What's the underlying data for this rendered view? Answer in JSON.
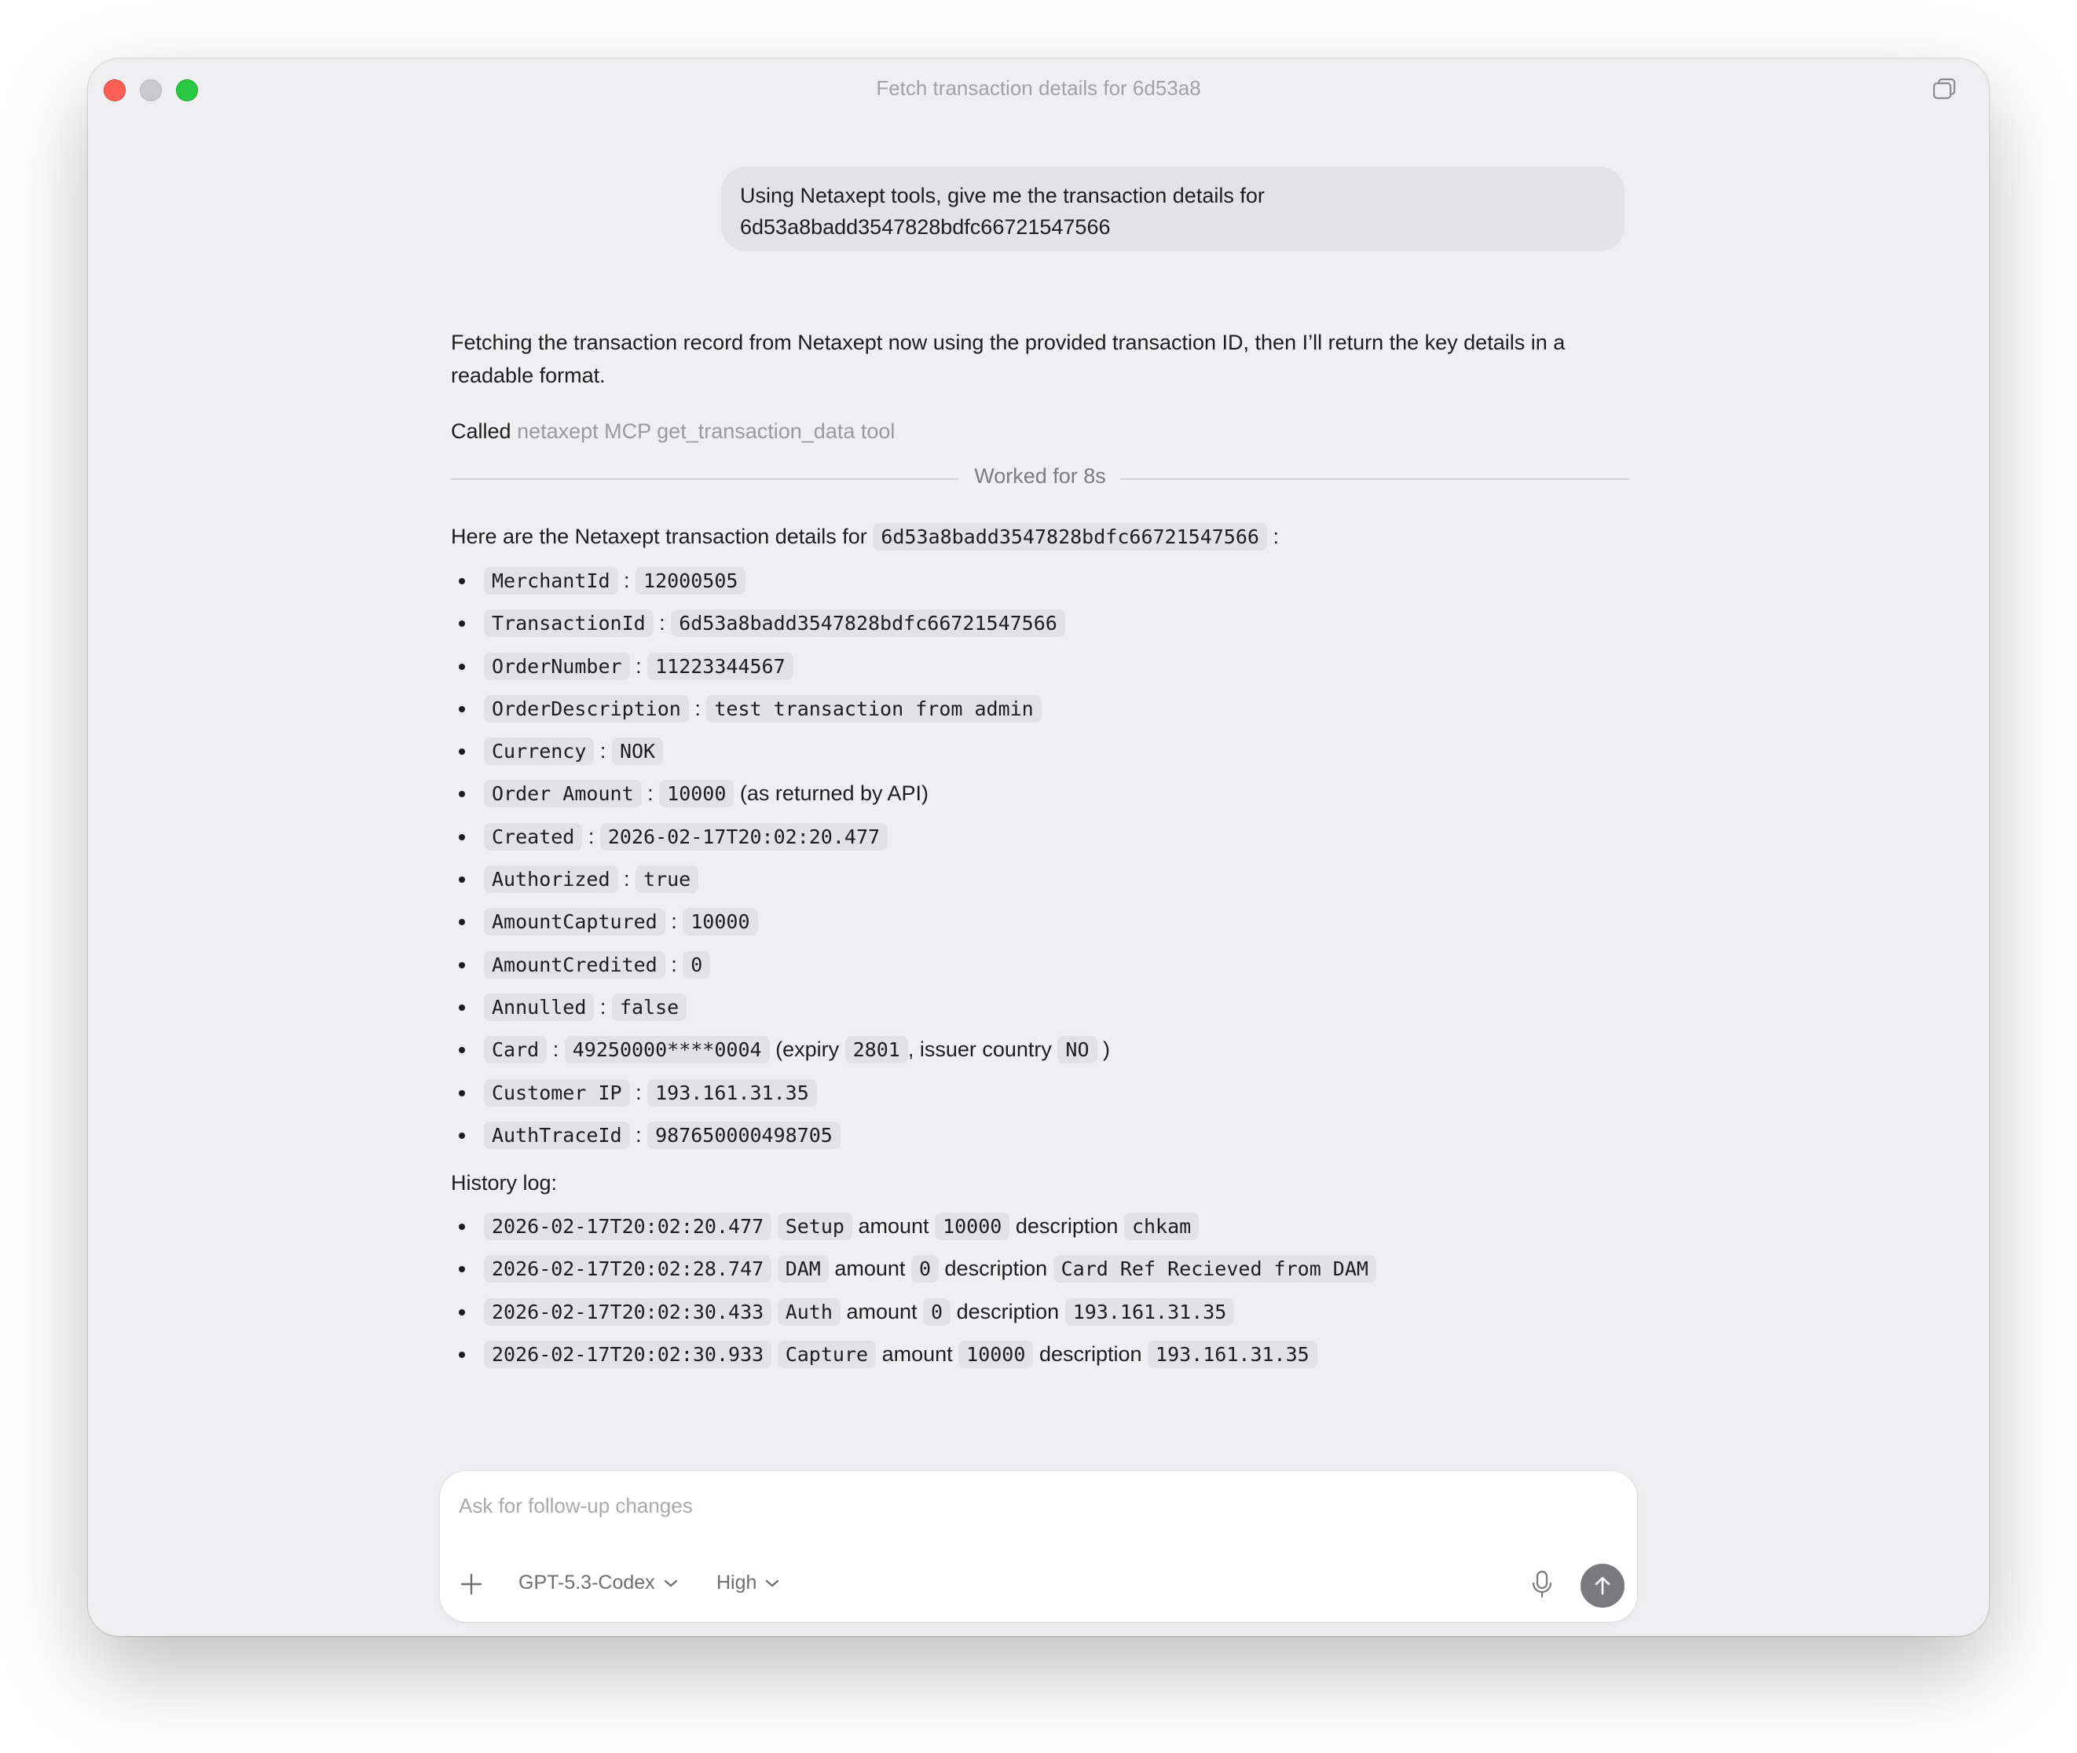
{
  "window": {
    "title": "Fetch transaction details for 6d53a8"
  },
  "user_message": {
    "line1": "Using Netaxept tools, give me the transaction details for",
    "line2": "6d53a8badd3547828bdfc66721547566"
  },
  "assistant": {
    "preface": "Fetching the transaction record from Netaxept now using the provided transaction ID, then I’ll return the key details in a readable format.",
    "called_prefix": "Called",
    "called_tool": "netaxept MCP get_transaction_data tool",
    "worked": "Worked for 8s",
    "intro_prefix": "Here are the Netaxept transaction details for",
    "intro_id": "6d53a8badd3547828bdfc66721547566",
    "intro_suffix": ":",
    "details": [
      {
        "key": "MerchantId",
        "value": "12000505"
      },
      {
        "key": "TransactionId",
        "value": "6d53a8badd3547828bdfc66721547566"
      },
      {
        "key": "OrderNumber",
        "value": "11223344567"
      },
      {
        "key": "OrderDescription",
        "value": "test transaction from admin"
      },
      {
        "key": "Currency",
        "value": "NOK"
      },
      {
        "key": "Order Amount",
        "value": "10000",
        "note": "(as returned by API)"
      },
      {
        "key": "Created",
        "value": "2026-02-17T20:02:20.477"
      },
      {
        "key": "Authorized",
        "value": "true"
      },
      {
        "key": "AmountCaptured",
        "value": "10000"
      },
      {
        "key": "AmountCredited",
        "value": "0"
      },
      {
        "key": "Annulled",
        "value": "false"
      },
      {
        "key": "Card",
        "value": "49250000****0004",
        "expiry_label": "(expiry",
        "expiry": "2801",
        "country_label": ", issuer country",
        "country": "NO",
        "close": ")"
      },
      {
        "key": "Customer IP",
        "value": "193.161.31.35"
      },
      {
        "key": "AuthTraceId",
        "value": "987650000498705"
      }
    ],
    "history_label": "History log:",
    "amount_word": "amount",
    "description_word": "description",
    "history": [
      {
        "time": "2026-02-17T20:02:20.477",
        "op": "Setup",
        "amount": "10000",
        "desc": "chkam"
      },
      {
        "time": "2026-02-17T20:02:28.747",
        "op": "DAM",
        "amount": "0",
        "desc": "Card Ref Recieved from DAM"
      },
      {
        "time": "2026-02-17T20:02:30.433",
        "op": "Auth",
        "amount": "0",
        "desc": "193.161.31.35"
      },
      {
        "time": "2026-02-17T20:02:30.933",
        "op": "Capture",
        "amount": "10000",
        "desc": "193.161.31.35"
      }
    ]
  },
  "composer": {
    "placeholder": "Ask for follow-up changes",
    "model": "GPT-5.3-Codex",
    "effort": "High"
  },
  "icons": {
    "add": "plus-icon",
    "mic": "microphone-icon",
    "send": "arrow-up-icon",
    "window": "copy-windows-icon"
  }
}
